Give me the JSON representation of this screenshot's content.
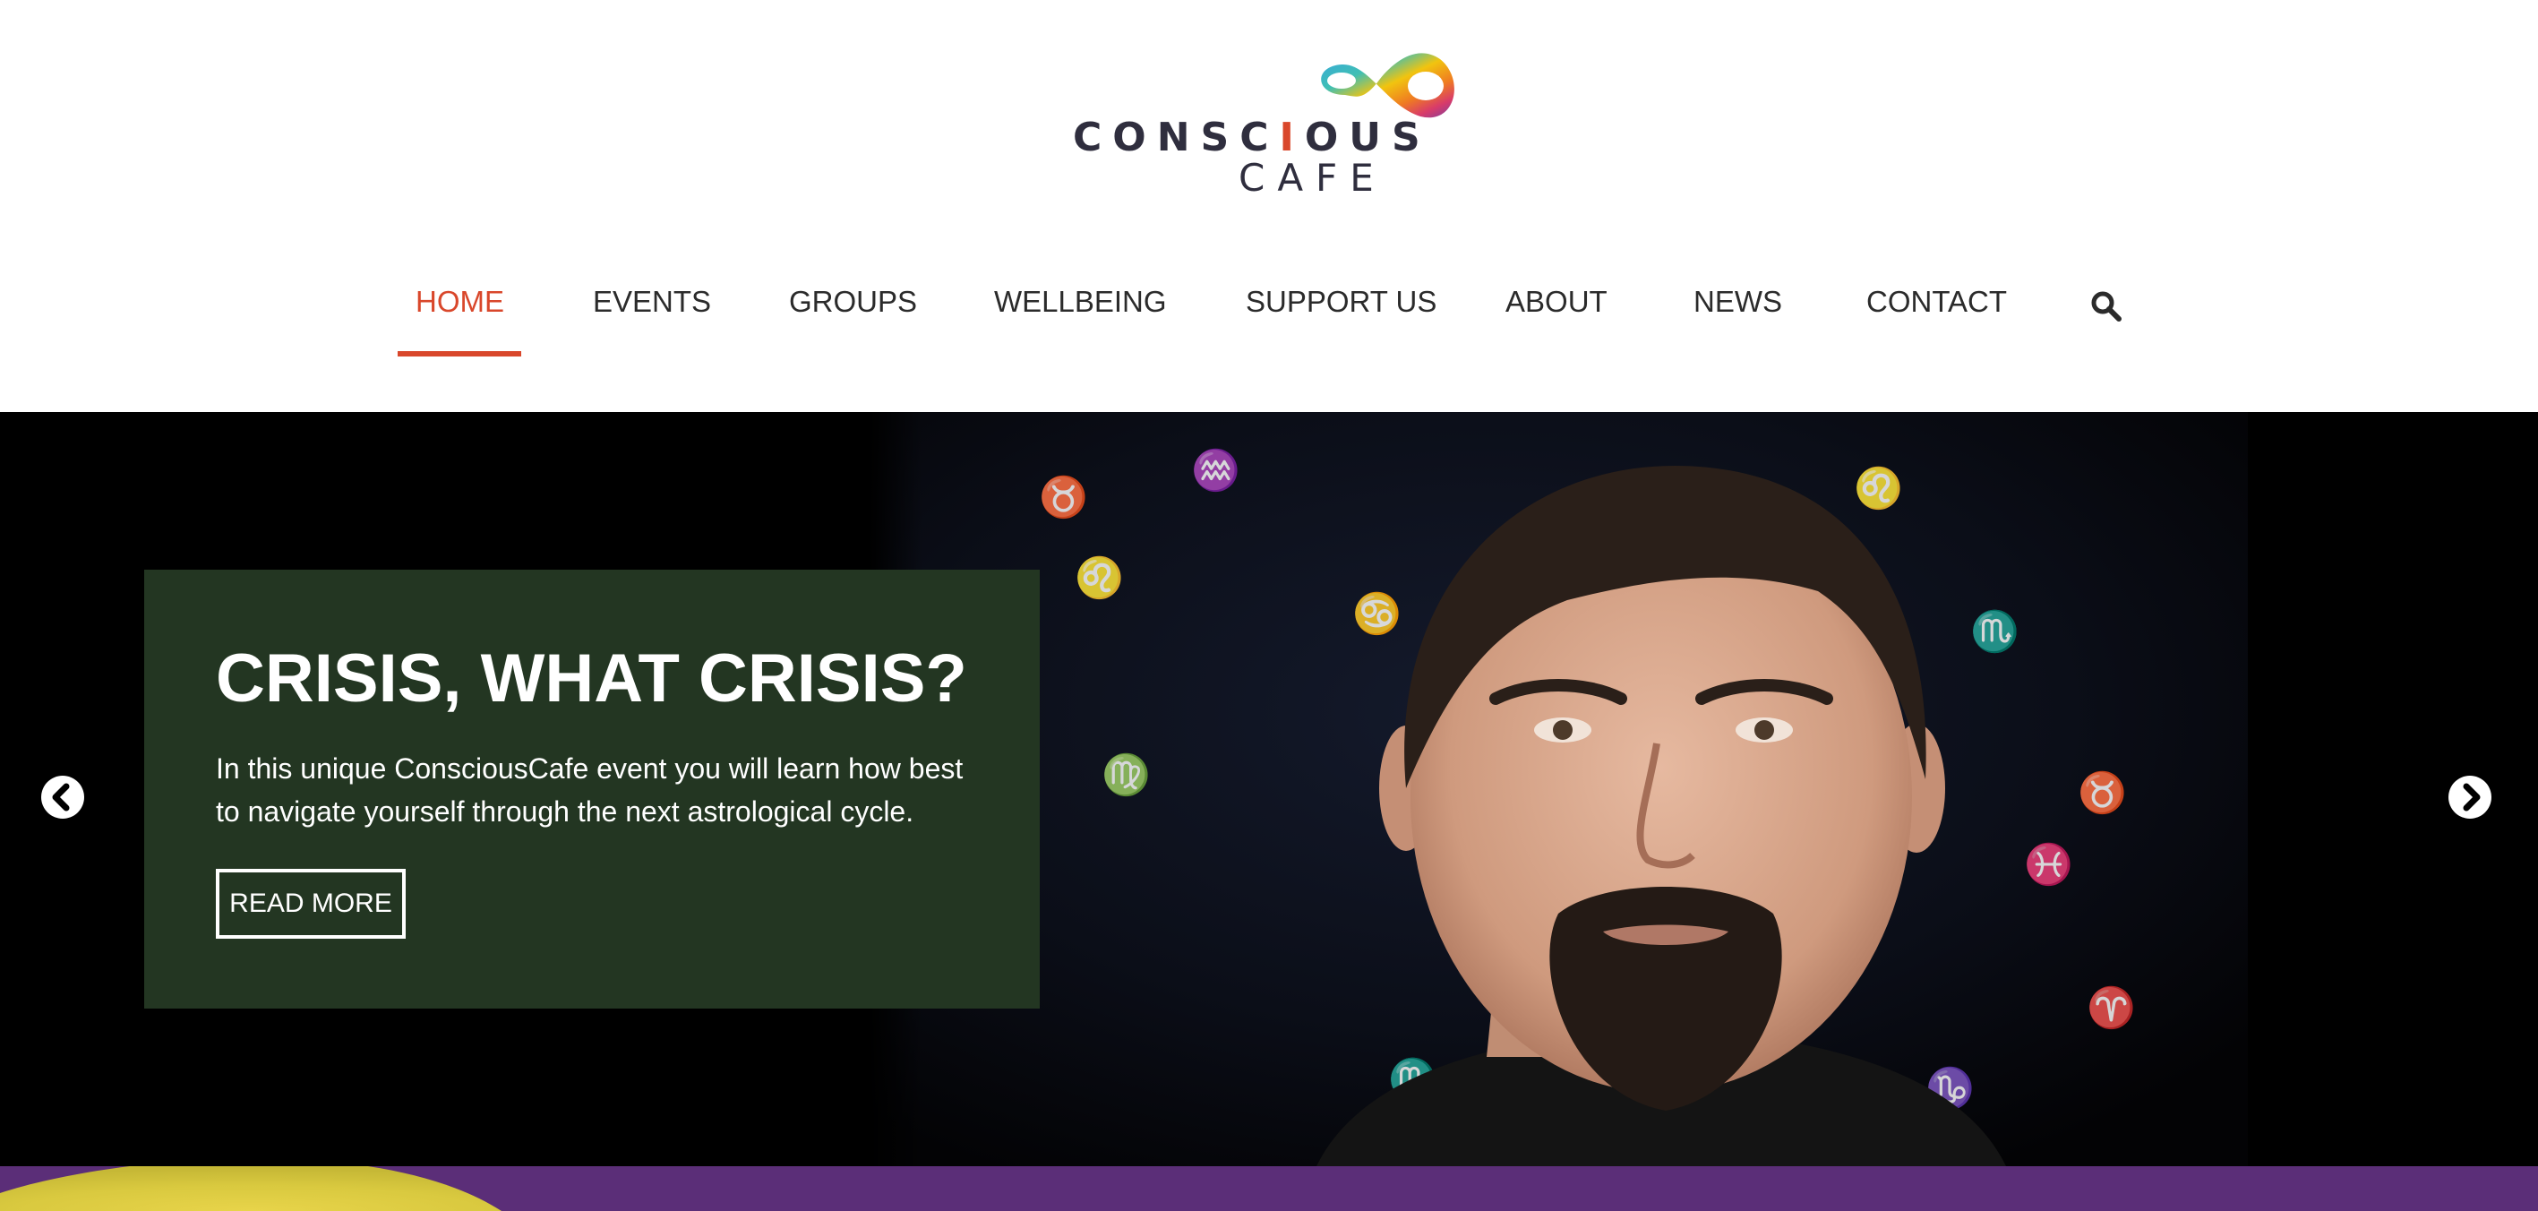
{
  "brand": {
    "logo_word": "CONSCIOUS",
    "logo_sub": "CAFE",
    "accent_color": "#d9472b",
    "caption_bg": "#233622",
    "strip_color": "#5b2e78"
  },
  "nav": {
    "items": [
      {
        "label": "HOME",
        "active": true
      },
      {
        "label": "EVENTS"
      },
      {
        "label": "GROUPS"
      },
      {
        "label": "WELLBEING"
      },
      {
        "label": "SUPPORT US"
      },
      {
        "label": "ABOUT"
      },
      {
        "label": "NEWS"
      },
      {
        "label": "CONTACT"
      }
    ],
    "search_icon": "search-icon"
  },
  "slide": {
    "title": "CRISIS, WHAT CRISIS?",
    "text": "In this unique ConsciousCafe event you will learn how best to navigate yourself through the next astrological cycle.",
    "button": "READ MORE",
    "prev_icon": "chevron-left-circle-icon",
    "next_icon": "chevron-right-circle-icon"
  }
}
